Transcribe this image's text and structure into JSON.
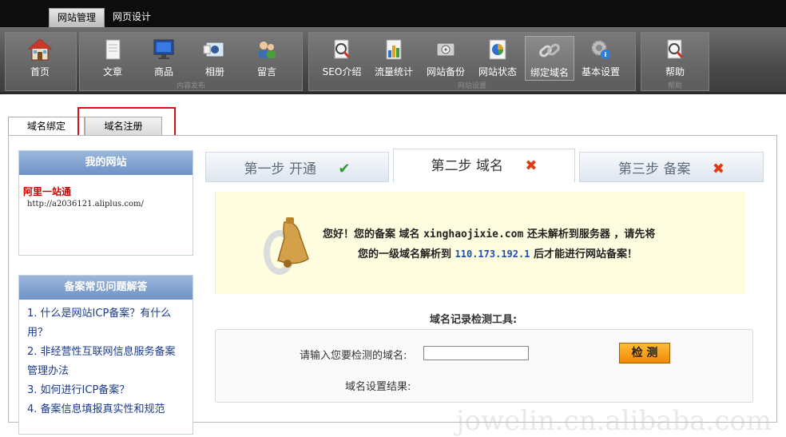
{
  "top_tabs": [
    "网站管理",
    "网页设计"
  ],
  "toolbar": {
    "home": "首页",
    "content_group": "内容发布",
    "article": "文章",
    "product": "商品",
    "album": "相册",
    "message": "留言",
    "site_group": "网站设置",
    "seo": "SEO介绍",
    "traffic": "流量统计",
    "backup": "网站备份",
    "status": "网站状态",
    "bind": "绑定域名",
    "basic": "基本设置",
    "help_group": "帮助",
    "help": "帮助"
  },
  "sub_tabs": [
    "域名绑定",
    "域名注册"
  ],
  "my_site": {
    "title": "我的网站",
    "name": "阿里一站通",
    "url": "http://a2036121.aliplus.com/"
  },
  "faq": {
    "title": "备案常见问题解答",
    "items": [
      "1. 什么是网站ICP备案？有什么用？",
      "2. 非经营性互联网信息服务备案管理办法",
      "3. 如何进行ICP备案？",
      "4. 备案信息填报真实性和规范"
    ]
  },
  "steps": [
    {
      "label": "第一步  开通",
      "mark": "✔",
      "color": "#2e9a2e"
    },
    {
      "label": "第二步  域名",
      "mark": "✖",
      "color": "#e03a12"
    },
    {
      "label": "第三步  备案",
      "mark": "✖",
      "color": "#e03a12"
    }
  ],
  "notice": {
    "l1_a": "您好！您的备案 域名 ",
    "domain": "xinghaojixie.com",
    "l1_b": " 还未解析到服务器 ，请先将",
    "l2_a": "您的一级域名解析到 ",
    "ip": "110.173.192.1",
    "l2_b": " 后才能进行网站备案！"
  },
  "tool": {
    "title": "域名记录检测工具:",
    "input_label": "请输入您要检测的域名:",
    "button": "检 测",
    "result_label": "域名设置结果:"
  },
  "watermark": "jowelin.cn.alibaba.com"
}
